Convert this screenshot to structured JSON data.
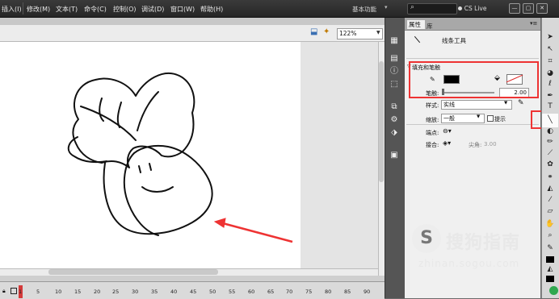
{
  "menu": [
    "插入(I)",
    "修改(M)",
    "文本(T)",
    "命令(C)",
    "控制(O)",
    "调试(D)",
    "窗口(W)",
    "帮助(H)"
  ],
  "titlebar": {
    "workspace": "基本功能",
    "search_icon": "search-icon",
    "cslive": "CS Live",
    "window_buttons": [
      "—",
      "▢",
      "✕"
    ]
  },
  "document": {
    "zoom": "122%",
    "timeline_ticks": [
      "1",
      "5",
      "10",
      "15",
      "20",
      "25",
      "30",
      "35",
      "40",
      "45",
      "50",
      "55",
      "60",
      "65",
      "70",
      "75",
      "80",
      "85",
      "90"
    ],
    "current_frame": "1"
  },
  "panel": {
    "tabs": [
      "属性",
      "库"
    ],
    "tool_name": "线条工具",
    "section_fill_stroke": "填充和笔触",
    "stroke_color": "#000000",
    "fill_color": "none",
    "stroke_label": "笔触:",
    "stroke_value": "2.00",
    "style_label": "样式:",
    "style_value": "实线",
    "scale_label": "缩放:",
    "scale_value": "一般",
    "hint_label": "提示",
    "hint_checked": false,
    "cap_label": "端点:",
    "join_label": "接合:",
    "miter_label": "尖角:",
    "miter_value": "3.00"
  },
  "tools": [
    "selection-tool",
    "subselection-tool",
    "free-transform-tool",
    "3d-rotation-tool",
    "lasso-tool",
    "pen-tool",
    "text-tool",
    "line-tool",
    "rectangle-tool",
    "pencil-tool",
    "brush-tool",
    "deco-tool",
    "bone-tool",
    "paint-bucket-tool",
    "eyedropper-tool",
    "eraser-tool",
    "hand-tool",
    "zoom-tool",
    "stroke-color",
    "fill-color"
  ],
  "watermark": {
    "brand": "搜狗指南",
    "url": "zhinan.sogou.com"
  },
  "colors": {
    "highlight": "#e33333",
    "accent": "#d43a3a"
  }
}
